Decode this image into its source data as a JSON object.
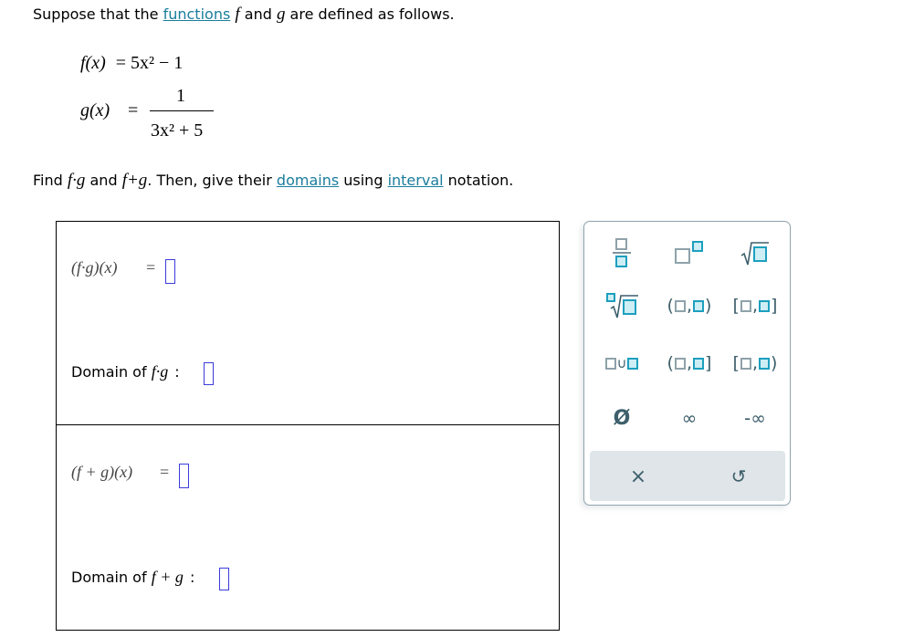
{
  "intro": {
    "prefix": "Suppose that the ",
    "link_functions": "functions",
    "var_f": "f",
    "and": " and ",
    "var_g": "g",
    "suffix": " are defined as follows."
  },
  "definitions": {
    "f_lhs": "f(x)",
    "f_rhs": "= 5x² − 1",
    "g_lhs": "g(x)",
    "g_eq": "=",
    "g_numerator": "1",
    "g_denominator": "3x² + 5"
  },
  "instruction": {
    "find": "Find ",
    "fg": "f·g",
    "and": " and ",
    "fplusg": "f+g",
    "middle": ". Then, give their ",
    "link_domains": "domains",
    "using": " using ",
    "link_interval": "interval",
    "suffix": " notation."
  },
  "answers": {
    "product_label": "(f·g)(x)",
    "product_eq": "=",
    "product_value": "",
    "product_domain_label": "Domain of ",
    "product_domain_expr": "f·g",
    "product_domain_colon": ":",
    "product_domain_value": "",
    "sum_label": "(f + g)(x)",
    "sum_eq": "=",
    "sum_value": "",
    "sum_domain_label": "Domain of ",
    "sum_domain_expr": "f + g",
    "sum_domain_colon": ":",
    "sum_domain_value": ""
  },
  "keypad": {
    "keys": [
      {
        "name": "fraction",
        "label": ""
      },
      {
        "name": "exponent",
        "label": ""
      },
      {
        "name": "square-root",
        "label": ""
      },
      {
        "name": "nth-root",
        "label": ""
      },
      {
        "name": "open-open-interval",
        "label": "(□,□)"
      },
      {
        "name": "closed-closed-interval",
        "label": "[□,□]"
      },
      {
        "name": "union",
        "label": "∪"
      },
      {
        "name": "open-closed-interval",
        "label": "(□,□]"
      },
      {
        "name": "closed-open-interval",
        "label": "[□,□)"
      },
      {
        "name": "empty-set",
        "label": "Ø"
      },
      {
        "name": "infinity",
        "label": "∞"
      },
      {
        "name": "negative-infinity",
        "label": "-∞"
      }
    ],
    "clear_label": "×",
    "undo_label": "↺",
    "colors": {
      "empty_box": "#8ea2aa",
      "filled_box": "#1d9fbf",
      "filled_bg": "#cdeef4",
      "glyph": "#3d5f6b",
      "bar": "#dfe5e8"
    }
  }
}
